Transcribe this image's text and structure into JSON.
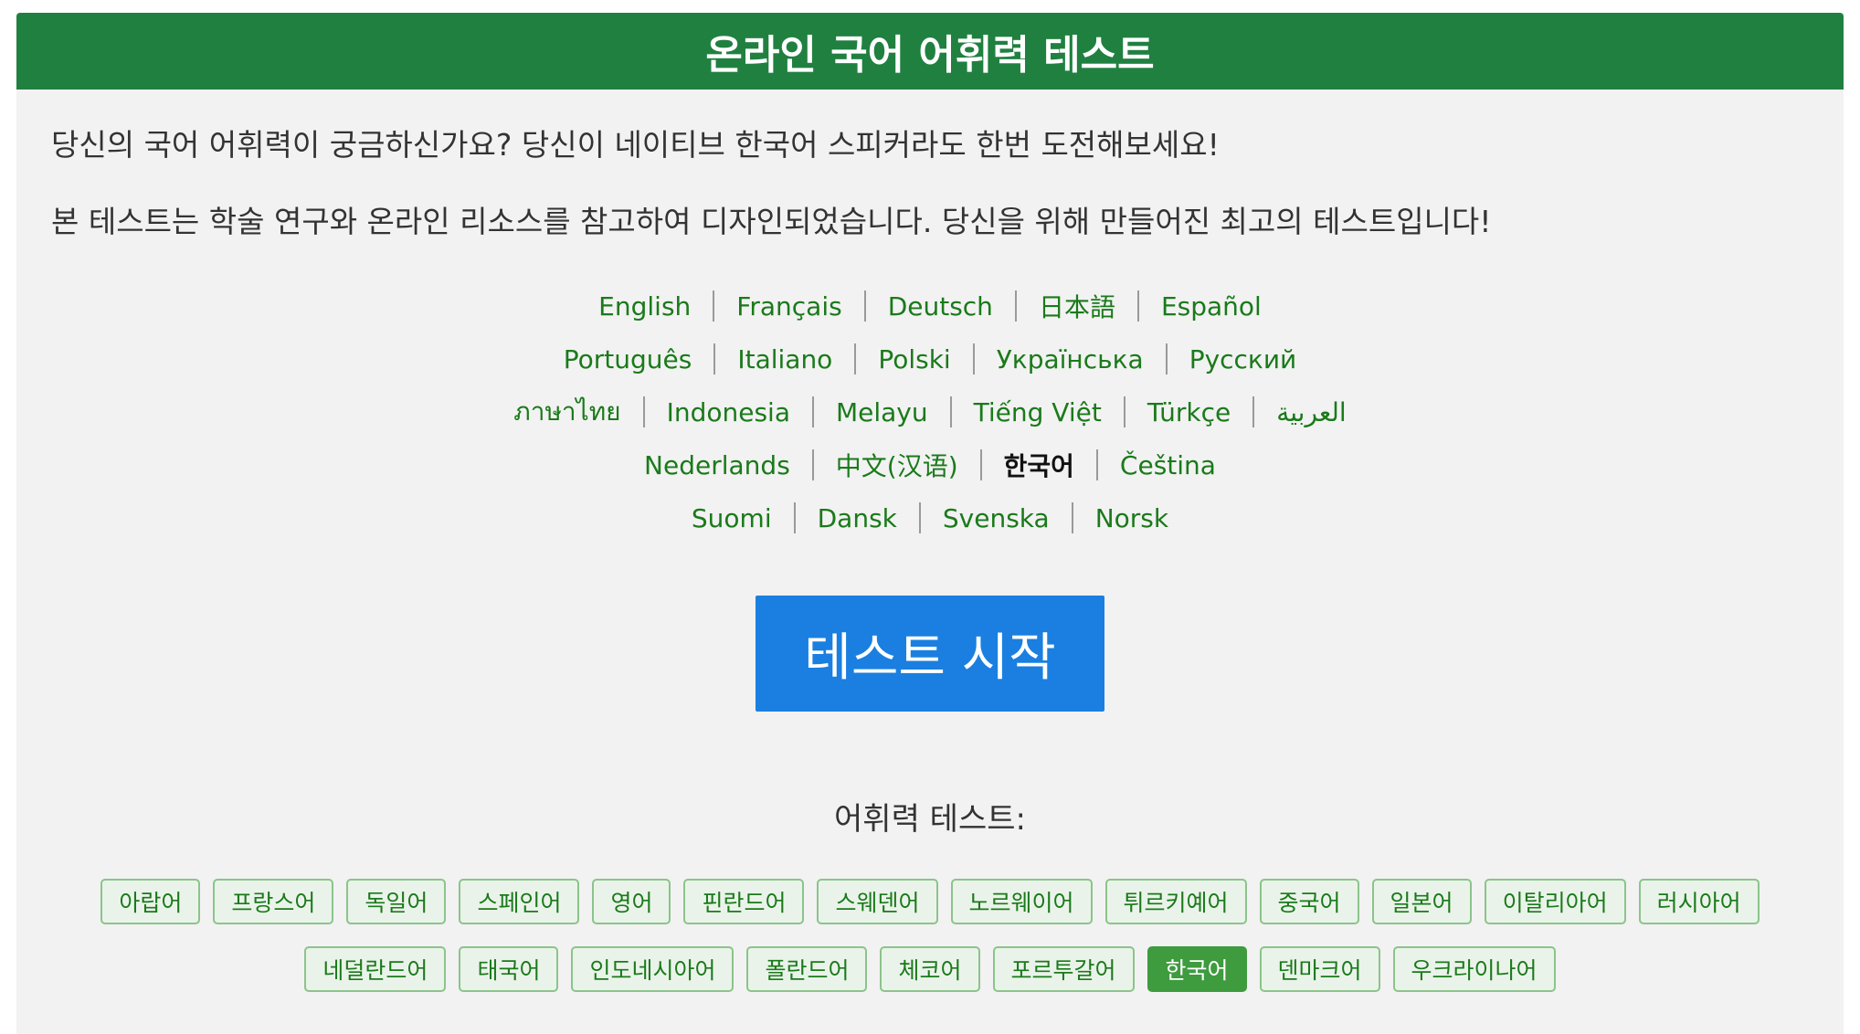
{
  "header": {
    "title": "온라인 국어 어휘력 테스트"
  },
  "intro": {
    "line1": "당신의 국어 어휘력이 궁금하신가요? 당신이 네이티브 한국어 스피커라도 한번 도전해보세요!",
    "line2": "본 테스트는 학술 연구와 온라인 리소스를 참고하여 디자인되었습니다. 당신을 위해 만들어진 최고의 테스트입니다!"
  },
  "languages": {
    "rows": [
      [
        "English",
        "Français",
        "Deutsch",
        "日本語",
        "Español"
      ],
      [
        "Português",
        "Italiano",
        "Polski",
        "Українська",
        "Русский"
      ],
      [
        "ภาษาไทย",
        "Indonesia",
        "Melayu",
        "Tiếng Việt",
        "Türkçe",
        "العربية"
      ],
      [
        "Nederlands",
        "中文(汉语)",
        "한국어",
        "Čeština"
      ],
      [
        "Suomi",
        "Dansk",
        "Svenska",
        "Norsk"
      ]
    ],
    "current": "한국어"
  },
  "start_button": {
    "label": "테스트 시작",
    "color": "#1a7fe0"
  },
  "vocab_tests": {
    "title": "어휘력 테스트:",
    "rows": [
      [
        "아랍어",
        "프랑스어",
        "독일어",
        "스페인어",
        "영어",
        "핀란드어",
        "스웨덴어",
        "노르웨이어",
        "튀르키예어",
        "중국어",
        "일본어",
        "이탈리아어",
        "러시아어"
      ],
      [
        "네덜란드어",
        "태국어",
        "인도네시아어",
        "폴란드어",
        "체코어",
        "포르투갈어",
        "한국어",
        "덴마크어",
        "우크라이나어"
      ]
    ],
    "active": "한국어"
  },
  "colors": {
    "header_green": "#208040",
    "link_green": "#1a7a1a",
    "chip_active": "#3e9b3e",
    "background": "#f2f2f2"
  }
}
